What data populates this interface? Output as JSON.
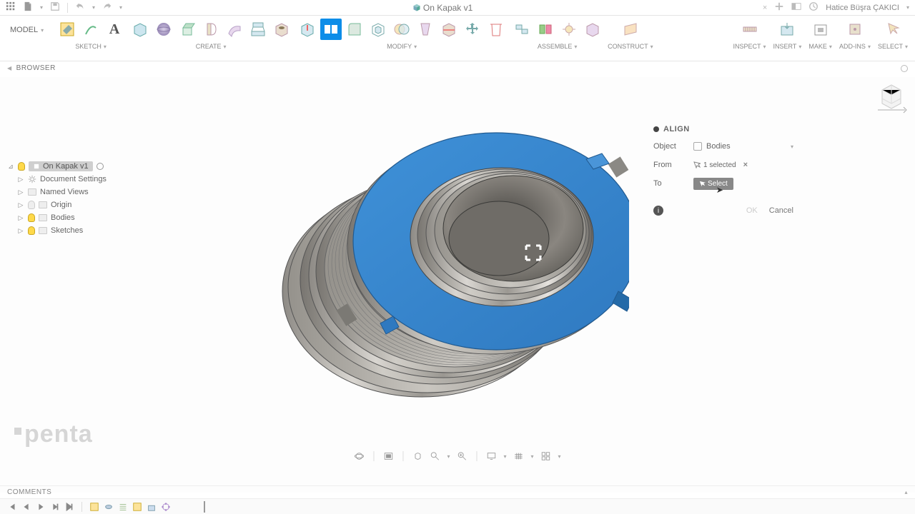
{
  "app": {
    "title": "On Kapak v1",
    "user": "Hatice Büşra ÇAKICI"
  },
  "ribbon": {
    "model_label": "MODEL",
    "groups": {
      "sketch": "SKETCH",
      "create": "CREATE",
      "modify": "MODIFY",
      "assemble": "ASSEMBLE",
      "construct": "CONSTRUCT",
      "inspect": "INSPECT",
      "insert": "INSERT",
      "make": "MAKE",
      "addins": "ADD-INS",
      "select": "SELECT"
    }
  },
  "browser": {
    "header": "BROWSER",
    "root": "On Kapak v1",
    "nodes": {
      "doc_settings": "Document Settings",
      "named_views": "Named Views",
      "origin": "Origin",
      "bodies": "Bodies",
      "sketches": "Sketches"
    }
  },
  "dialog": {
    "title": "ALIGN",
    "object_label": "Object",
    "object_value": "Bodies",
    "from_label": "From",
    "from_value": "1 selected",
    "to_label": "To",
    "to_value": "Select",
    "ok": "OK",
    "cancel": "Cancel"
  },
  "comments": {
    "label": "COMMENTS"
  },
  "watermark": {
    "penta": "penta"
  }
}
